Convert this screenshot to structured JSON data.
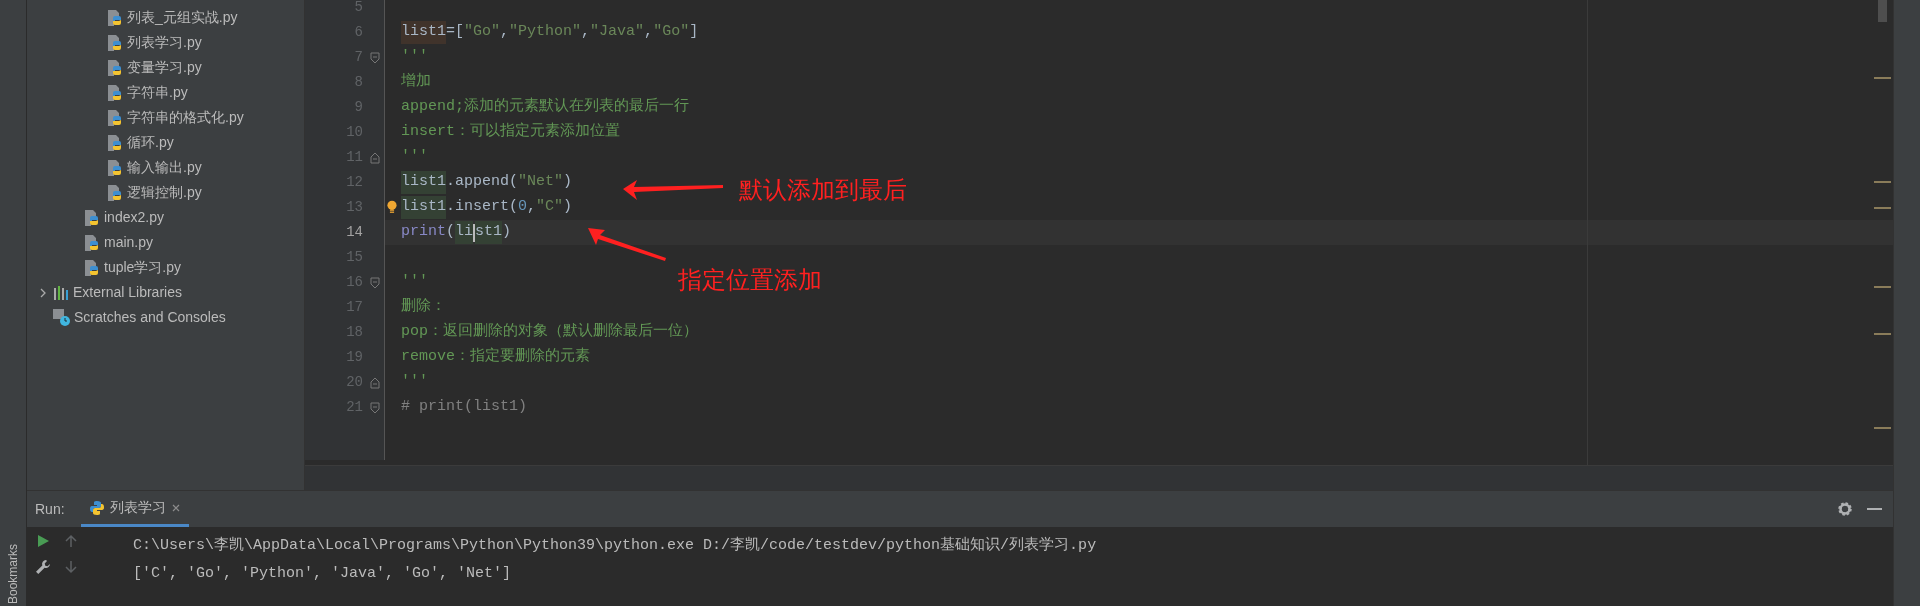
{
  "project_tree": {
    "nested_files": [
      {
        "name": "列表_元组实战.py"
      },
      {
        "name": "列表学习.py"
      },
      {
        "name": "变量学习.py"
      },
      {
        "name": "字符串.py"
      },
      {
        "name": "字符串的格式化.py"
      },
      {
        "name": "循环.py"
      },
      {
        "name": "输入输出.py"
      },
      {
        "name": "逻辑控制.py"
      }
    ],
    "files": [
      {
        "name": "index2.py"
      },
      {
        "name": "main.py"
      },
      {
        "name": "tuple学习.py"
      }
    ],
    "roots": [
      {
        "name": "External Libraries",
        "kind": "libraries",
        "expanded": false
      },
      {
        "name": "Scratches and Consoles",
        "kind": "scratches"
      }
    ]
  },
  "editor": {
    "lines": [
      {
        "number": "5",
        "selected": false,
        "bulb": false,
        "fold_start": false,
        "fold_end": false
      },
      {
        "number": "6",
        "selected": false,
        "bulb": false,
        "fold_start": false,
        "fold_end": false,
        "segments": [
          {
            "text": "list1",
            "kind": "plain",
            "color": "#40332b"
          },
          {
            "text": "=[",
            "kind": "plain"
          },
          {
            "text": "\"Go\"",
            "kind": "string"
          },
          {
            "text": ",",
            "kind": "plain"
          },
          {
            "text": "\"Python\"",
            "kind": "string"
          },
          {
            "text": ",",
            "kind": "plain"
          },
          {
            "text": "\"Java\"",
            "kind": "string"
          },
          {
            "text": ",",
            "kind": "plain"
          },
          {
            "text": "\"Go\"",
            "kind": "string"
          },
          {
            "text": "]",
            "kind": "plain"
          }
        ]
      },
      {
        "number": "7",
        "selected": false,
        "bulb": false,
        "fold_start": true,
        "fold_end": false,
        "segments": [
          {
            "text": "'''",
            "kind": "doc"
          }
        ]
      },
      {
        "number": "8",
        "selected": false,
        "bulb": false,
        "fold_start": false,
        "fold_end": false,
        "segments": [
          {
            "text": "增加",
            "kind": "doc"
          }
        ]
      },
      {
        "number": "9",
        "selected": false,
        "bulb": false,
        "fold_start": false,
        "fold_end": false,
        "segments": [
          {
            "text": "append;添加的元素默认在列表的最后一行",
            "kind": "doc"
          }
        ]
      },
      {
        "number": "10",
        "selected": false,
        "bulb": false,
        "fold_start": false,
        "fold_end": false,
        "segments": [
          {
            "text": "insert：可以指定元素添加位置",
            "kind": "doc"
          }
        ]
      },
      {
        "number": "11",
        "selected": false,
        "bulb": false,
        "fold_start": false,
        "fold_end": true,
        "segments": [
          {
            "text": "'''",
            "kind": "doc"
          }
        ]
      },
      {
        "number": "12",
        "selected": false,
        "bulb": false,
        "fold_start": false,
        "fold_end": false,
        "segments": [
          {
            "text": "list1",
            "kind": "plain",
            "color": "#344134"
          },
          {
            "text": ".append(",
            "kind": "plain"
          },
          {
            "text": "\"Net\"",
            "kind": "string"
          },
          {
            "text": ")",
            "kind": "plain"
          }
        ]
      },
      {
        "number": "13",
        "selected": false,
        "bulb": true,
        "fold_start": false,
        "fold_end": false,
        "segments": [
          {
            "text": "list1",
            "kind": "plain",
            "color": "#344134"
          },
          {
            "text": ".insert(",
            "kind": "plain"
          },
          {
            "text": "0",
            "kind": "number"
          },
          {
            "text": ",",
            "kind": "plain"
          },
          {
            "text": "\"C\"",
            "kind": "string"
          },
          {
            "text": ")",
            "kind": "plain"
          }
        ]
      },
      {
        "number": "14",
        "selected": true,
        "bulb": false,
        "fold_start": false,
        "fold_end": false,
        "segments": [
          {
            "text": "print",
            "kind": "builtin"
          },
          {
            "text": "(",
            "kind": "plain"
          },
          {
            "text": "li",
            "kind": "plain",
            "color": "#344134"
          },
          {
            "kind": "caret"
          },
          {
            "text": "st1",
            "kind": "plain",
            "color": "#344134"
          },
          {
            "text": ")",
            "kind": "plain"
          }
        ]
      },
      {
        "number": "15",
        "selected": false,
        "bulb": false,
        "fold_start": false,
        "fold_end": false
      },
      {
        "number": "16",
        "selected": false,
        "bulb": false,
        "fold_start": true,
        "fold_end": false,
        "segments": [
          {
            "text": "'''",
            "kind": "doc"
          }
        ]
      },
      {
        "number": "17",
        "selected": false,
        "bulb": false,
        "fold_start": false,
        "fold_end": false,
        "segments": [
          {
            "text": "删除：",
            "kind": "doc"
          }
        ]
      },
      {
        "number": "18",
        "selected": false,
        "bulb": false,
        "fold_start": false,
        "fold_end": false,
        "segments": [
          {
            "text": "pop：返回删除的对象（默认删除最后一位）",
            "kind": "doc"
          }
        ]
      },
      {
        "number": "19",
        "selected": false,
        "bulb": false,
        "fold_start": false,
        "fold_end": false,
        "segments": [
          {
            "text": "remove：指定要删除的元素",
            "kind": "doc"
          }
        ]
      },
      {
        "number": "20",
        "selected": false,
        "bulb": false,
        "fold_start": false,
        "fold_end": true,
        "segments": [
          {
            "text": "'''",
            "kind": "doc"
          }
        ]
      },
      {
        "number": "21",
        "selected": false,
        "bulb": false,
        "fold_start": true,
        "fold_end": false,
        "segments": [
          {
            "text": "# print(list1)",
            "kind": "comment"
          }
        ]
      }
    ]
  },
  "annotations": [
    {
      "text": "默认添加到最后"
    },
    {
      "text": "指定位置添加"
    }
  ],
  "run_panel": {
    "label": "Run:",
    "tabs": [
      {
        "label": "列表学习",
        "selected": true
      }
    ],
    "toolbar": [
      {
        "kind": "run",
        "disabled": false
      },
      {
        "kind": "up",
        "disabled": true
      },
      {
        "kind": "wrench",
        "disabled": false
      },
      {
        "kind": "down",
        "disabled": true
      }
    ],
    "output": [
      "C:\\Users\\李凯\\AppData\\Local\\Programs\\Python\\Python39\\python.exe D:/李凯/code/testdev/python基础知识/列表学习.py",
      "['C', 'Go', 'Python', 'Java', 'Go', 'Net']"
    ]
  },
  "side_strip": {
    "label": "Bookmarks"
  }
}
